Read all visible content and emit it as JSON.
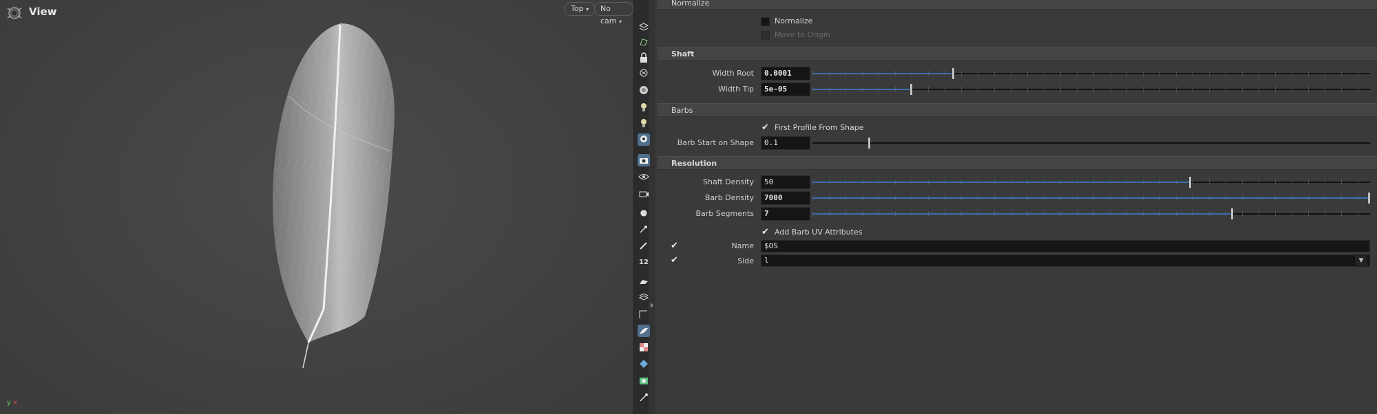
{
  "viewport": {
    "title": "View",
    "view_button": "Top",
    "camera_button": "No cam",
    "axis_y": "y",
    "axis_x": "x"
  },
  "shelf": {
    "icons": [
      "display-options-icon",
      "geometry-view-icon",
      "lock-icon",
      "ghost-icon",
      "bulb-icon",
      "light-icon",
      "light-link-icon",
      "snapshot-icon",
      "camera-icon",
      "visibility-icon",
      "vis-cam-icon",
      "point-icon",
      "pin-icon",
      "pen-icon",
      "number-icon",
      "brush-icon",
      "stack-icon",
      "path-icon",
      "feather-icon",
      "checker-icon",
      "layer-icon",
      "map-icon",
      "wand-icon"
    ],
    "number_badge": "12"
  },
  "panel": {
    "normalize": {
      "header": "Normalize",
      "normalize_label": "Normalize",
      "move_to_origin_label": "Move to Origin"
    },
    "shaft": {
      "header": "Shaft",
      "width_root_label": "Width Root",
      "width_root_value": "0.0001",
      "width_root_pct": 0.25,
      "width_tip_label": "Width Tip",
      "width_tip_value": "5e-05",
      "width_tip_pct": 0.175
    },
    "barbs": {
      "header": "Barbs",
      "first_profile_label": "First Profile From Shape",
      "barb_start_label": "Barb Start on Shape",
      "barb_start_value": "0.1",
      "barb_start_pct": 0.1
    },
    "resolution": {
      "header": "Resolution",
      "shaft_density_label": "Shaft Density",
      "shaft_density_value": "50",
      "shaft_density_pct": 0.675,
      "barb_density_label": "Barb Density",
      "barb_density_value": "7000",
      "barb_density_pct": 1.0,
      "barb_segments_label": "Barb Segments",
      "barb_segments_value": "7",
      "barb_segments_pct": 0.75,
      "add_uv_label": "Add Barb UV Attributes",
      "name_label": "Name",
      "name_value": "$OS",
      "side_label": "Side",
      "side_value": "l"
    }
  }
}
